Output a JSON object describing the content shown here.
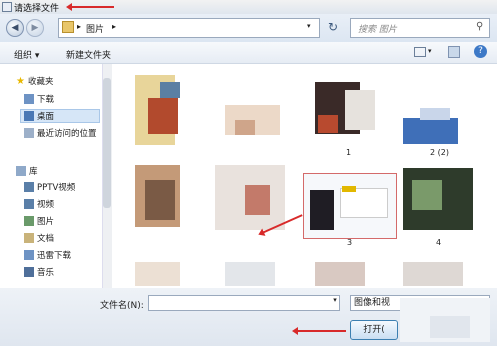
{
  "window": {
    "title": "请选择文件"
  },
  "address": {
    "segments": [
      "图片"
    ],
    "search_placeholder": "搜索 图片"
  },
  "toolbar": {
    "organize": "组织 ▾",
    "new_folder": "新建文件夹"
  },
  "nav": {
    "favorites": "收藏夹",
    "items": [
      "下载",
      "桌面",
      "最近访问的位置"
    ],
    "library": "库",
    "lib_items": [
      "PPTV视频",
      "视频",
      "图片",
      "文档",
      "迅雷下载",
      "音乐"
    ]
  },
  "files": [
    {
      "label": "1"
    },
    {
      "label": "2 (2)"
    },
    {
      "label": "3"
    },
    {
      "label": "4"
    }
  ],
  "bottom": {
    "filename_label": "文件名(N):",
    "filename_value": "",
    "filetype": "图像和视",
    "open_button": "打开("
  },
  "colors": {
    "annotation_red": "#d82a2a",
    "selection_border": "#d46a6a"
  }
}
